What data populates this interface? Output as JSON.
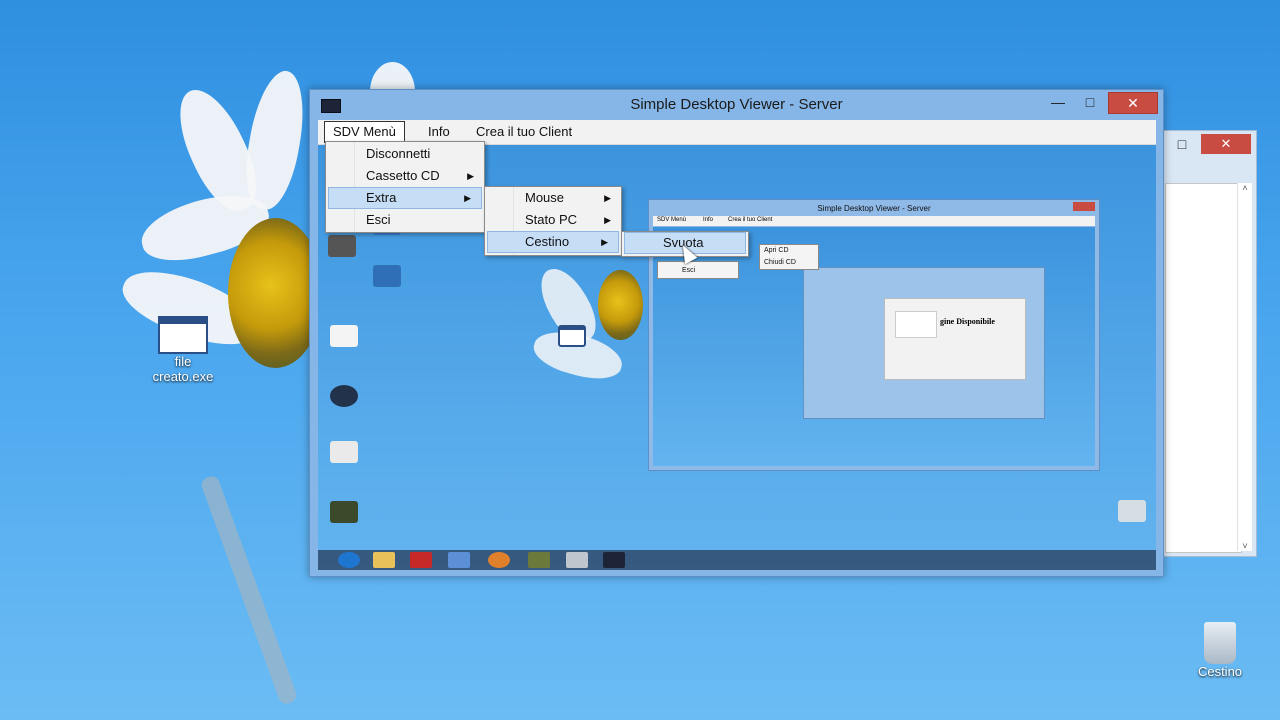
{
  "window": {
    "title": "Simple Desktop Viewer - Server",
    "minimize": "—",
    "maximize": "□",
    "close": "✕"
  },
  "menubar": [
    "SDV Menù",
    "Info",
    "Crea il tuo Client"
  ],
  "sdv_menu": [
    {
      "label": "Disconnetti",
      "has_sub": false
    },
    {
      "label": "Cassetto CD",
      "has_sub": true
    },
    {
      "label": "Extra",
      "has_sub": true
    },
    {
      "label": "Esci",
      "has_sub": false
    }
  ],
  "extra_menu": [
    {
      "label": "Mouse",
      "has_sub": true
    },
    {
      "label": "Stato PC",
      "has_sub": true
    },
    {
      "label": "Cestino",
      "has_sub": true
    }
  ],
  "cestino_menu": [
    {
      "label": "Svuota"
    }
  ],
  "nested": {
    "title": "Simple Desktop Viewer - Server",
    "menubar": [
      "SDV Menù",
      "Info",
      "Crea il tuo Client"
    ],
    "cd_menu": [
      "Apri CD",
      "Chiudi CD"
    ],
    "esci": "Esci",
    "dialog_text": "gine Disponibile"
  },
  "desktop": {
    "file_icon_label": "file\ncreato.exe",
    "recycle_label": "Cestino"
  },
  "side_window": {
    "maximize": "□",
    "close": "✕",
    "scroll_up": "˄",
    "scroll_down": "˅"
  },
  "colors": {
    "close_red": "#c94c43",
    "menu_highlight": "#c6ddf6",
    "desktop_blue": "#3f9be6"
  }
}
